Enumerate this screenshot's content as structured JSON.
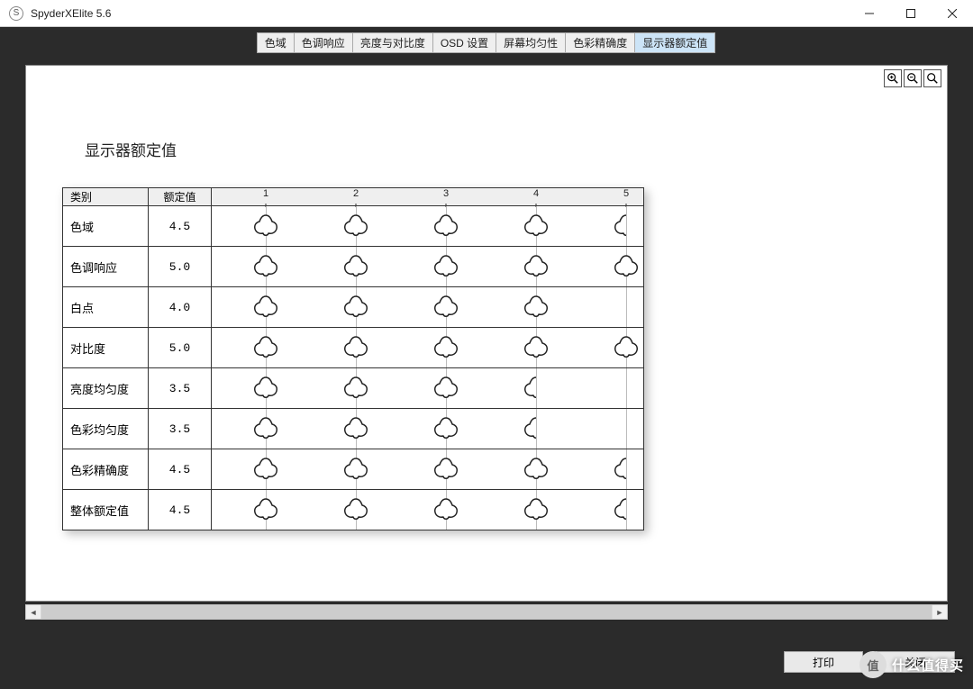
{
  "window": {
    "title": "SpyderXElite 5.6",
    "icon_label": "S"
  },
  "tabs": {
    "items": [
      {
        "label": "色域",
        "active": false
      },
      {
        "label": "色调响应",
        "active": false
      },
      {
        "label": "亮度与对比度",
        "active": false
      },
      {
        "label": "OSD 设置",
        "active": false
      },
      {
        "label": "屏幕均匀性",
        "active": false
      },
      {
        "label": "色彩精确度",
        "active": false
      },
      {
        "label": "显示器额定值",
        "active": true
      }
    ]
  },
  "page": {
    "title": "显示器额定值",
    "col_category": "类别",
    "col_rating": "额定值",
    "axis_labels": [
      "1",
      "2",
      "3",
      "4",
      "5"
    ]
  },
  "chart_data": {
    "type": "table",
    "columns": [
      "类别",
      "额定值"
    ],
    "rows": [
      {
        "category": "色域",
        "rating": 4.5
      },
      {
        "category": "色调响应",
        "rating": 5.0
      },
      {
        "category": "白点",
        "rating": 4.0
      },
      {
        "category": "对比度",
        "rating": 5.0
      },
      {
        "category": "亮度均匀度",
        "rating": 3.5
      },
      {
        "category": "色彩均匀度",
        "rating": 3.5
      },
      {
        "category": "色彩精确度",
        "rating": 4.5
      },
      {
        "category": "整体额定值",
        "rating": 4.5
      }
    ],
    "scale": {
      "min": 1,
      "max": 5,
      "step": 1
    }
  },
  "buttons": {
    "print": "打印",
    "close": "关闭"
  },
  "watermark": {
    "badge": "值",
    "text": "什么值得买"
  }
}
